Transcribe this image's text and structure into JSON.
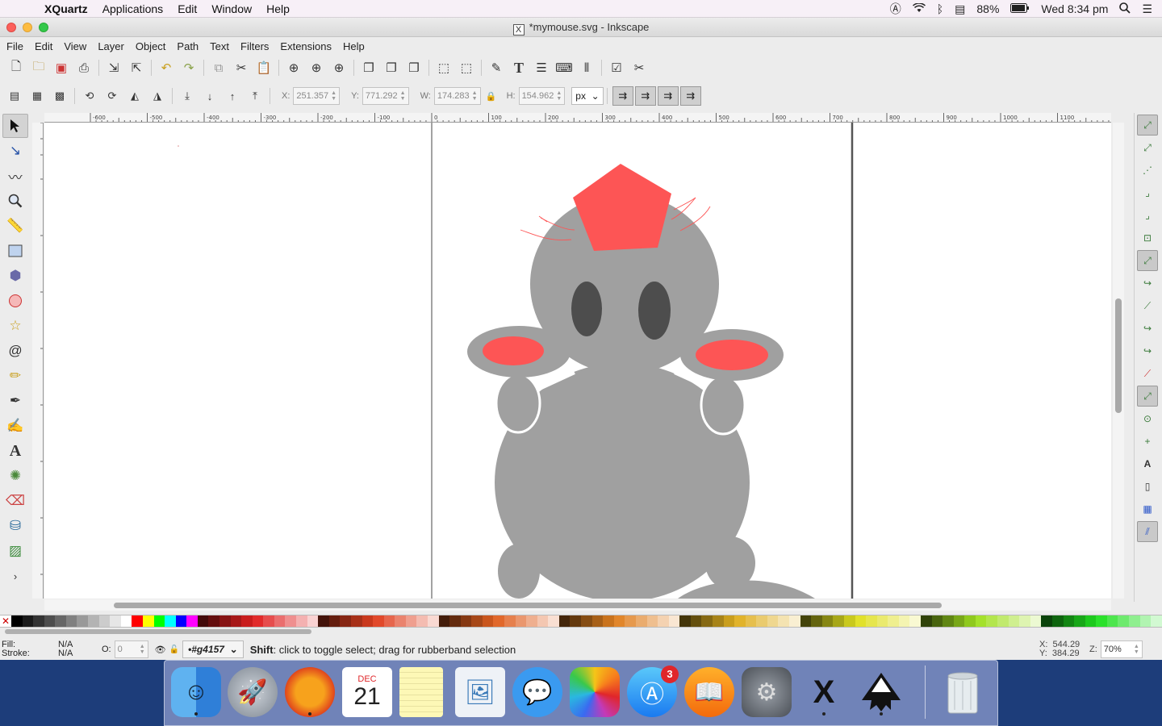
{
  "menubar": {
    "app_name": "XQuartz",
    "items": [
      "Applications",
      "Edit",
      "Window",
      "Help"
    ],
    "battery": "88%",
    "clock": "Wed 8:34 pm"
  },
  "window": {
    "title": "*mymouse.svg - Inkscape",
    "x_icon": "X"
  },
  "app_menu": [
    "File",
    "Edit",
    "View",
    "Layer",
    "Object",
    "Path",
    "Text",
    "Filters",
    "Extensions",
    "Help"
  ],
  "controls": {
    "x_label": "X:",
    "x_value": "251.357",
    "y_label": "Y:",
    "y_value": "771.292",
    "w_label": "W:",
    "w_value": "174.283",
    "h_label": "H:",
    "h_value": "154.962",
    "unit": "px"
  },
  "ruler": {
    "h_labels": [
      "-600",
      "-500",
      "-400",
      "-300",
      "-200",
      "-100",
      "0",
      "100",
      "200",
      "300",
      "400",
      "500",
      "600",
      "700",
      "800",
      "900",
      "1000",
      "1100"
    ]
  },
  "status": {
    "fill_label": "Fill:",
    "fill_value": "N/A",
    "stroke_label": "Stroke:",
    "stroke_value": "N/A",
    "opacity_label": "O:",
    "opacity_value": "0",
    "layer": "•#g4157",
    "message_bold": "Shift",
    "message_rest": ": click to toggle select; drag for rubberband selection",
    "cursor_x_label": "X:",
    "cursor_x": "544.29",
    "cursor_y_label": "Y:",
    "cursor_y": "384.29",
    "zoom_label": "Z:",
    "zoom": "70%"
  },
  "dock": {
    "calendar_month": "DEC",
    "calendar_day": "21",
    "appstore_badge": "3"
  },
  "colors": {
    "mouse_body": "#a0a0a0",
    "accent_red": "#fd5555",
    "eye": "#4d4d4d"
  }
}
